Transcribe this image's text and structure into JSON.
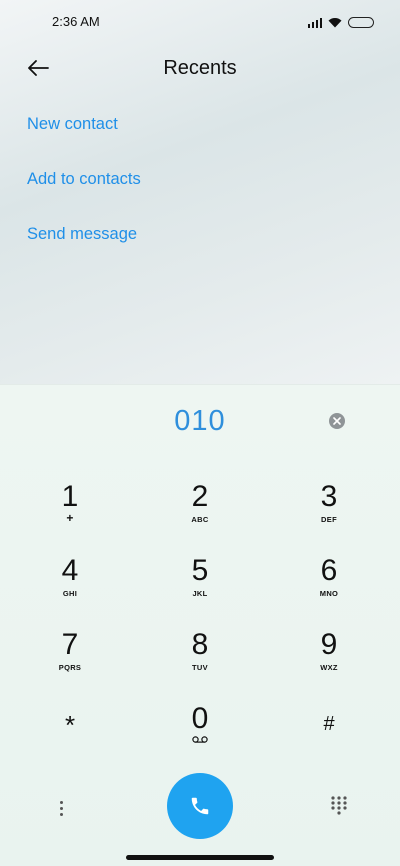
{
  "status_bar": {
    "time": "2:36 AM"
  },
  "header": {
    "title": "Recents"
  },
  "actions": {
    "new_contact": "New contact",
    "add_to_contacts": "Add to contacts",
    "send_message": "Send message"
  },
  "dialer": {
    "number": "010",
    "keys": [
      {
        "digit": "1",
        "letters": "+"
      },
      {
        "digit": "2",
        "letters": "ABC"
      },
      {
        "digit": "3",
        "letters": "DEF"
      },
      {
        "digit": "4",
        "letters": "GHI"
      },
      {
        "digit": "5",
        "letters": "JKL"
      },
      {
        "digit": "6",
        "letters": "MNO"
      },
      {
        "digit": "7",
        "letters": "PQRS"
      },
      {
        "digit": "8",
        "letters": "TUV"
      },
      {
        "digit": "9",
        "letters": "WXZ"
      },
      {
        "digit": "*",
        "letters": ""
      },
      {
        "digit": "0",
        "letters": ""
      },
      {
        "digit": "#",
        "letters": ""
      }
    ]
  },
  "colors": {
    "accent": "#1f8fe8",
    "call_button": "#1fa3f0",
    "number": "#2f8fdc"
  },
  "icons": [
    "back-arrow-icon",
    "signal-icon",
    "wifi-icon",
    "battery-icon",
    "clear-icon",
    "voicemail-icon",
    "more-icon",
    "phone-icon",
    "keypad-icon"
  ]
}
